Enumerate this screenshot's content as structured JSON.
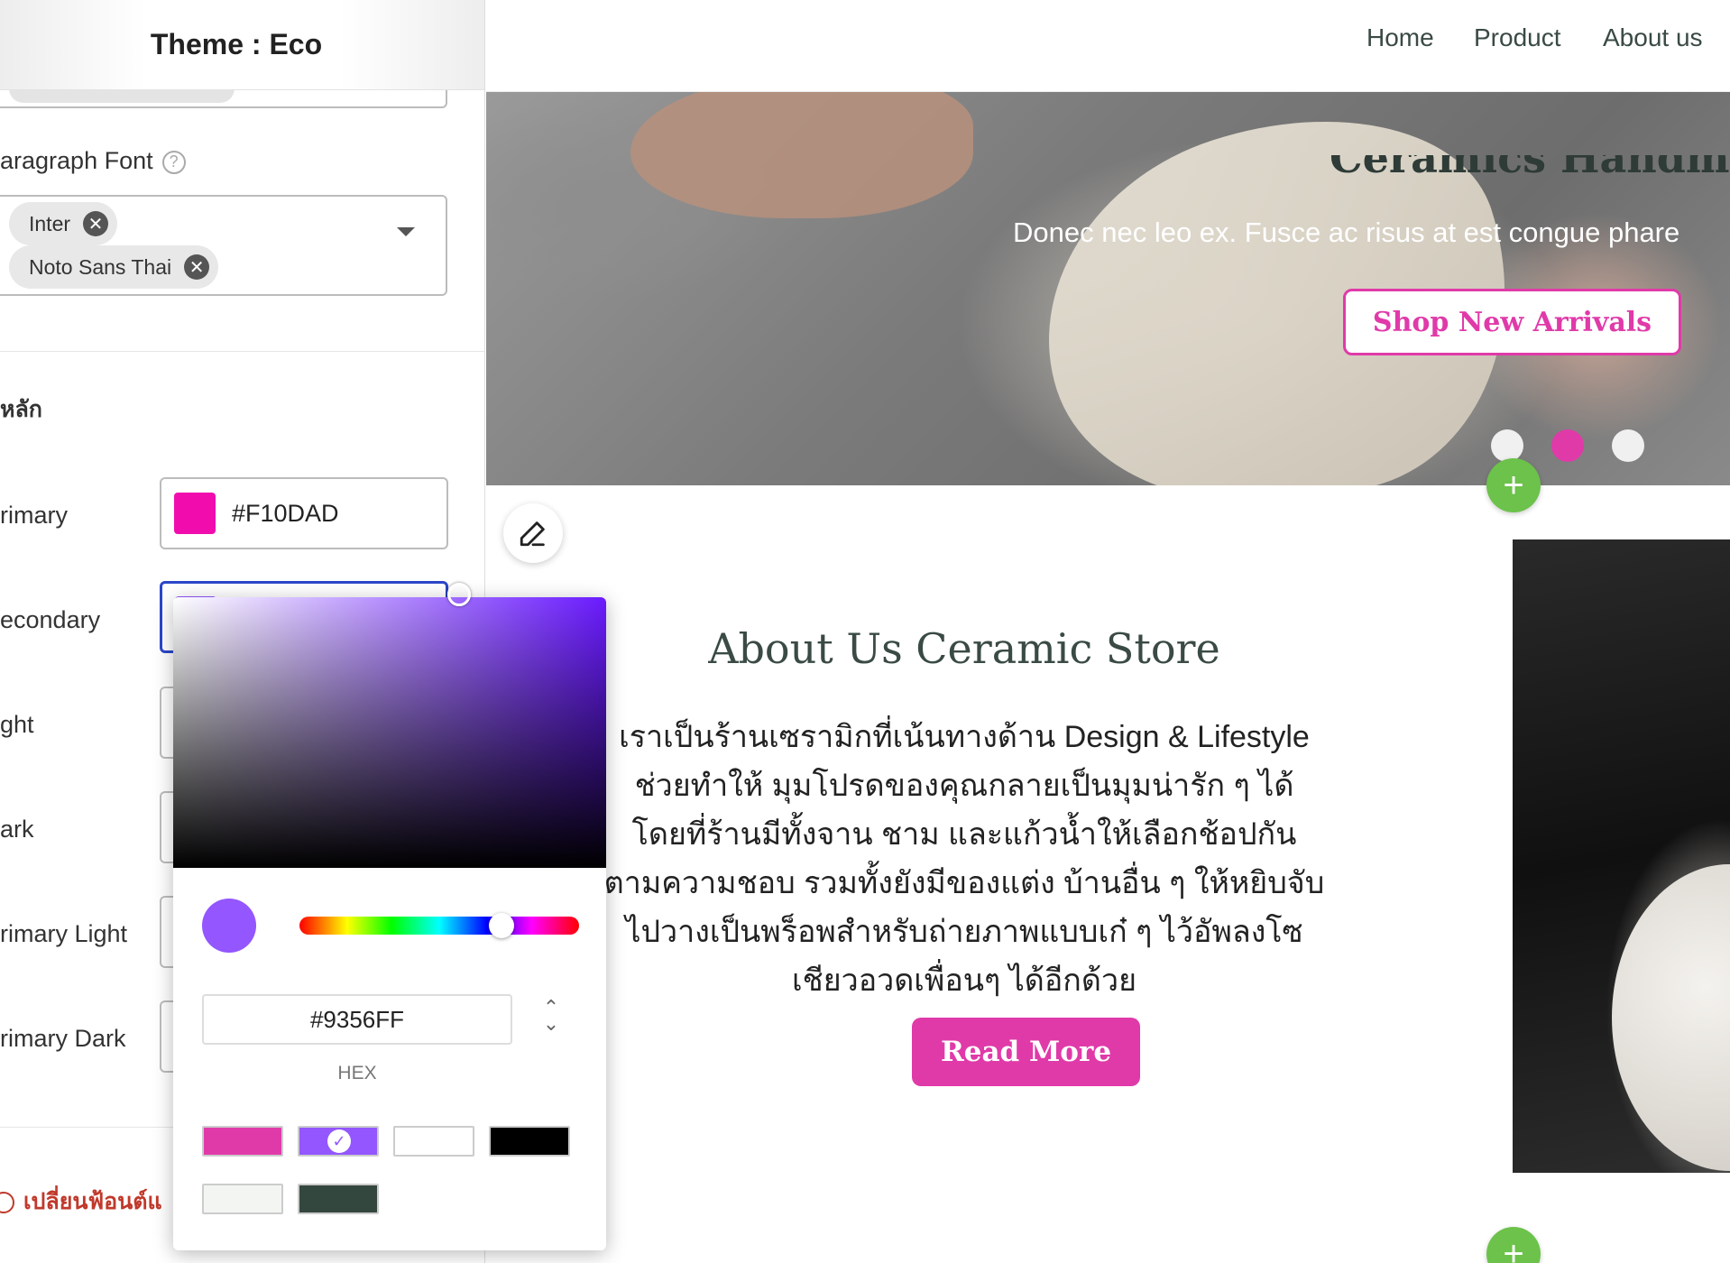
{
  "panel": {
    "title": "Theme : Eco",
    "paragraph_font_label": "aragraph Font",
    "help_icon": "?",
    "fonts": [
      "Inter",
      "Noto Sans Thai"
    ],
    "remove_glyph": "✕",
    "section_label": "หลัก",
    "colors": {
      "primary_label": "rimary",
      "primary_value": "#F10DAD",
      "secondary_label": "econdary",
      "light_label": "ght",
      "dark_label": "ark",
      "primary_light_label": "rimary Light",
      "primary_dark_label": "rimary Dark"
    },
    "warning": "เปลี่ยนฟ้อนต์แ"
  },
  "nav": {
    "links": [
      "Home",
      "Product",
      "About us"
    ]
  },
  "hero": {
    "title": "Ceramics Handmade",
    "subtitle": "Donec nec leo ex. Fusce ac risus at est congue phare",
    "button": "Shop New Arrivals"
  },
  "about": {
    "title": "About Us Ceramic Store",
    "text": "เราเป็นร้านเซรามิกที่เน้นทางด้าน Design & Lifestyle ช่วยทำให้ มุมโปรดของคุณกลายเป็นมุมน่ารัก ๆ ได้ โดยที่ร้านมีทั้งจาน ชาม และแก้วน้ำให้เลือกช้อปกันตามความชอบ รวมทั้งยังมีของแต่ง บ้านอื่น ๆ ให้หยิบจับไปวางเป็นพร็อพสำหรับถ่ายภาพแบบเก๋ ๆ ไว้อัพลงโซเชียวอวดเพื่อนๆ ได้อีกด้วย",
    "button": "Read More"
  },
  "controls": {
    "add_glyph": "+",
    "edit_icon": "pencil-icon"
  },
  "picker": {
    "hex_value": "#9356FF",
    "mode_label": "HEX",
    "toggle_glyph": "⌃⌄",
    "check_glyph": "✓",
    "presets": [
      "#E03AA9",
      "#9356FF",
      "#FFFFFF",
      "#000000",
      "#F3F5F2",
      "#34473F"
    ]
  },
  "colors": {
    "primary": "#F10DAD",
    "secondary": "#9356FF",
    "brand_pink": "#E03AA9",
    "heading_green": "#3A4A45",
    "add_green": "#6CC24A"
  }
}
